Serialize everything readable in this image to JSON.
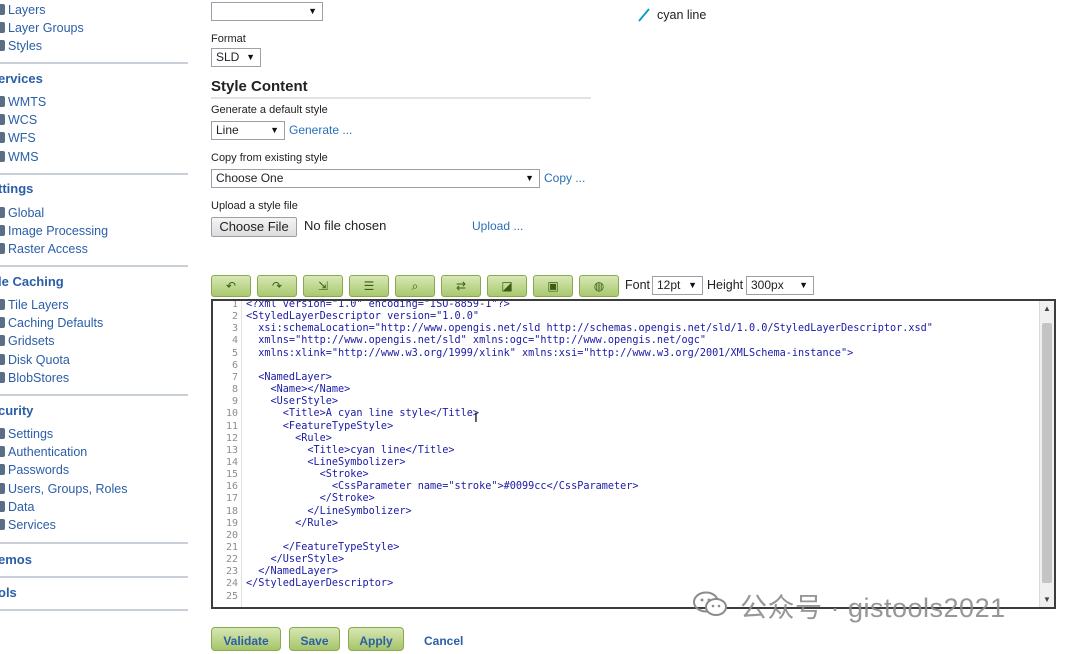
{
  "sidebar": {
    "top_items": [
      {
        "label": "Layers"
      },
      {
        "label": "Layer Groups"
      },
      {
        "label": "Styles"
      }
    ],
    "services": {
      "heading": "ervices",
      "items": [
        {
          "label": "WMTS"
        },
        {
          "label": "WCS"
        },
        {
          "label": "WFS"
        },
        {
          "label": "WMS"
        }
      ]
    },
    "settings": {
      "heading": "ttings",
      "items": [
        {
          "label": "Global"
        },
        {
          "label": "Image Processing"
        },
        {
          "label": "Raster Access"
        }
      ]
    },
    "tile_caching": {
      "heading": "le Caching",
      "items": [
        {
          "label": "Tile Layers"
        },
        {
          "label": "Caching Defaults"
        },
        {
          "label": "Gridsets"
        },
        {
          "label": "Disk Quota"
        },
        {
          "label": "BlobStores"
        }
      ]
    },
    "security": {
      "heading": "curity",
      "items": [
        {
          "label": "Settings"
        },
        {
          "label": "Authentication"
        },
        {
          "label": "Passwords"
        },
        {
          "label": "Users, Groups, Roles"
        },
        {
          "label": "Data"
        },
        {
          "label": "Services"
        }
      ]
    },
    "demos": {
      "heading": "emos"
    },
    "tools": {
      "heading": "ols"
    }
  },
  "form": {
    "top_select_value": "",
    "format_label": "Format",
    "format_value": "SLD",
    "style_content_title": "Style Content",
    "generate_label": "Generate a default style",
    "generate_value": "Line",
    "generate_link": "Generate ...",
    "copy_label": "Copy from existing style",
    "copy_value": "Choose One",
    "copy_link": "Copy ...",
    "upload_label": "Upload a style file",
    "choose_file_button": "Choose File",
    "no_file_text": "No file chosen",
    "upload_link": "Upload ..."
  },
  "legend": {
    "label": "cyan line",
    "color": "#0099cc"
  },
  "toolbar": {
    "buttons": [
      {
        "icon": "undo-icon"
      },
      {
        "icon": "redo-icon"
      },
      {
        "icon": "go-to-line-icon"
      },
      {
        "icon": "reformat-icon"
      },
      {
        "icon": "search-icon"
      },
      {
        "icon": "replace-icon"
      },
      {
        "icon": "color-picker-icon"
      },
      {
        "icon": "preview-image-icon"
      },
      {
        "icon": "legend-icon"
      }
    ],
    "font_label": "Font",
    "font_value": "12pt",
    "height_label": "Height",
    "height_value": "300px"
  },
  "editor": {
    "lines": [
      {
        "n": "1",
        "text": "<?xml version=\"1.0\" encoding=\"ISO-8859-1\"?>"
      },
      {
        "n": "2",
        "text": "<StyledLayerDescriptor version=\"1.0.0\""
      },
      {
        "n": "3",
        "text": "  xsi:schemaLocation=\"http://www.opengis.net/sld http://schemas.opengis.net/sld/1.0.0/StyledLayerDescriptor.xsd\""
      },
      {
        "n": "4",
        "text": "  xmlns=\"http://www.opengis.net/sld\" xmlns:ogc=\"http://www.opengis.net/ogc\""
      },
      {
        "n": "5",
        "text": "  xmlns:xlink=\"http://www.w3.org/1999/xlink\" xmlns:xsi=\"http://www.w3.org/2001/XMLSchema-instance\">"
      },
      {
        "n": "6",
        "text": ""
      },
      {
        "n": "7",
        "text": "  <NamedLayer>"
      },
      {
        "n": "8",
        "text": "    <Name></Name>"
      },
      {
        "n": "9",
        "text": "    <UserStyle>"
      },
      {
        "n": "10",
        "text": "      <Title>A cyan line style</Title>"
      },
      {
        "n": "11",
        "text": "      <FeatureTypeStyle>"
      },
      {
        "n": "12",
        "text": "        <Rule>"
      },
      {
        "n": "13",
        "text": "          <Title>cyan line</Title>"
      },
      {
        "n": "14",
        "text": "          <LineSymbolizer>"
      },
      {
        "n": "15",
        "text": "            <Stroke>"
      },
      {
        "n": "16",
        "text": "              <CssParameter name=\"stroke\">#0099cc</CssParameter>"
      },
      {
        "n": "17",
        "text": "            </Stroke>"
      },
      {
        "n": "18",
        "text": "          </LineSymbolizer>"
      },
      {
        "n": "19",
        "text": "        </Rule>"
      },
      {
        "n": "20",
        "text": ""
      },
      {
        "n": "21",
        "text": "      </FeatureTypeStyle>"
      },
      {
        "n": "22",
        "text": "    </UserStyle>"
      },
      {
        "n": "23",
        "text": "  </NamedLayer>"
      },
      {
        "n": "24",
        "text": "</StyledLayerDescriptor>"
      },
      {
        "n": "25",
        "text": ""
      }
    ]
  },
  "actions": {
    "validate": "Validate",
    "save": "Save",
    "apply": "Apply",
    "cancel": "Cancel"
  },
  "watermark": {
    "text": "公众号 · gistools2021"
  }
}
